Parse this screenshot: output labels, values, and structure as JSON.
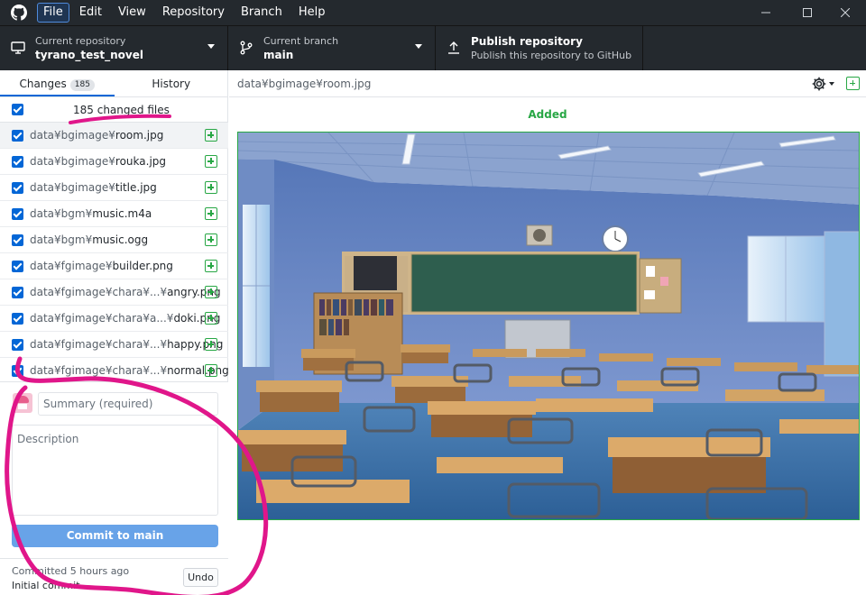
{
  "menu": {
    "items": [
      "File",
      "Edit",
      "View",
      "Repository",
      "Branch",
      "Help"
    ]
  },
  "toolbar": {
    "repo": {
      "label": "Current repository",
      "value": "tyrano_test_novel"
    },
    "branch": {
      "label": "Current branch",
      "value": "main"
    },
    "publish": {
      "label": "Publish repository",
      "value": "Publish this repository to GitHub"
    }
  },
  "sidebar": {
    "tabs": {
      "changes": "Changes",
      "changes_count": "185",
      "history": "History"
    },
    "changed_files_label": "185 changed files",
    "files": [
      {
        "dir": "data¥bgimage¥",
        "name": "room.jpg"
      },
      {
        "dir": "data¥bgimage¥",
        "name": "rouka.jpg"
      },
      {
        "dir": "data¥bgimage¥",
        "name": "title.jpg"
      },
      {
        "dir": "data¥bgm¥",
        "name": "music.m4a"
      },
      {
        "dir": "data¥bgm¥",
        "name": "music.ogg"
      },
      {
        "dir": "data¥fgimage¥",
        "name": "builder.png"
      },
      {
        "dir": "data¥fgimage¥chara¥...¥",
        "name": "angry.png"
      },
      {
        "dir": "data¥fgimage¥chara¥a...¥",
        "name": "doki.png"
      },
      {
        "dir": "data¥fgimage¥chara¥...¥",
        "name": "happy.png"
      },
      {
        "dir": "data¥fgimage¥chara¥...¥",
        "name": "normal.png"
      }
    ],
    "commit": {
      "summary_placeholder": "Summary (required)",
      "description_placeholder": "Description",
      "button_prefix": "Commit to ",
      "button_branch": "main"
    },
    "last_commit": {
      "time": "Committed 5 hours ago",
      "message": "Initial commit",
      "undo": "Undo"
    }
  },
  "diff": {
    "path": "data¥bgimage¥room.jpg",
    "status": "Added"
  },
  "colors": {
    "chrome": "#24292e",
    "accent": "#0366d6",
    "added": "#28a745",
    "annotation": "#e0168a"
  }
}
